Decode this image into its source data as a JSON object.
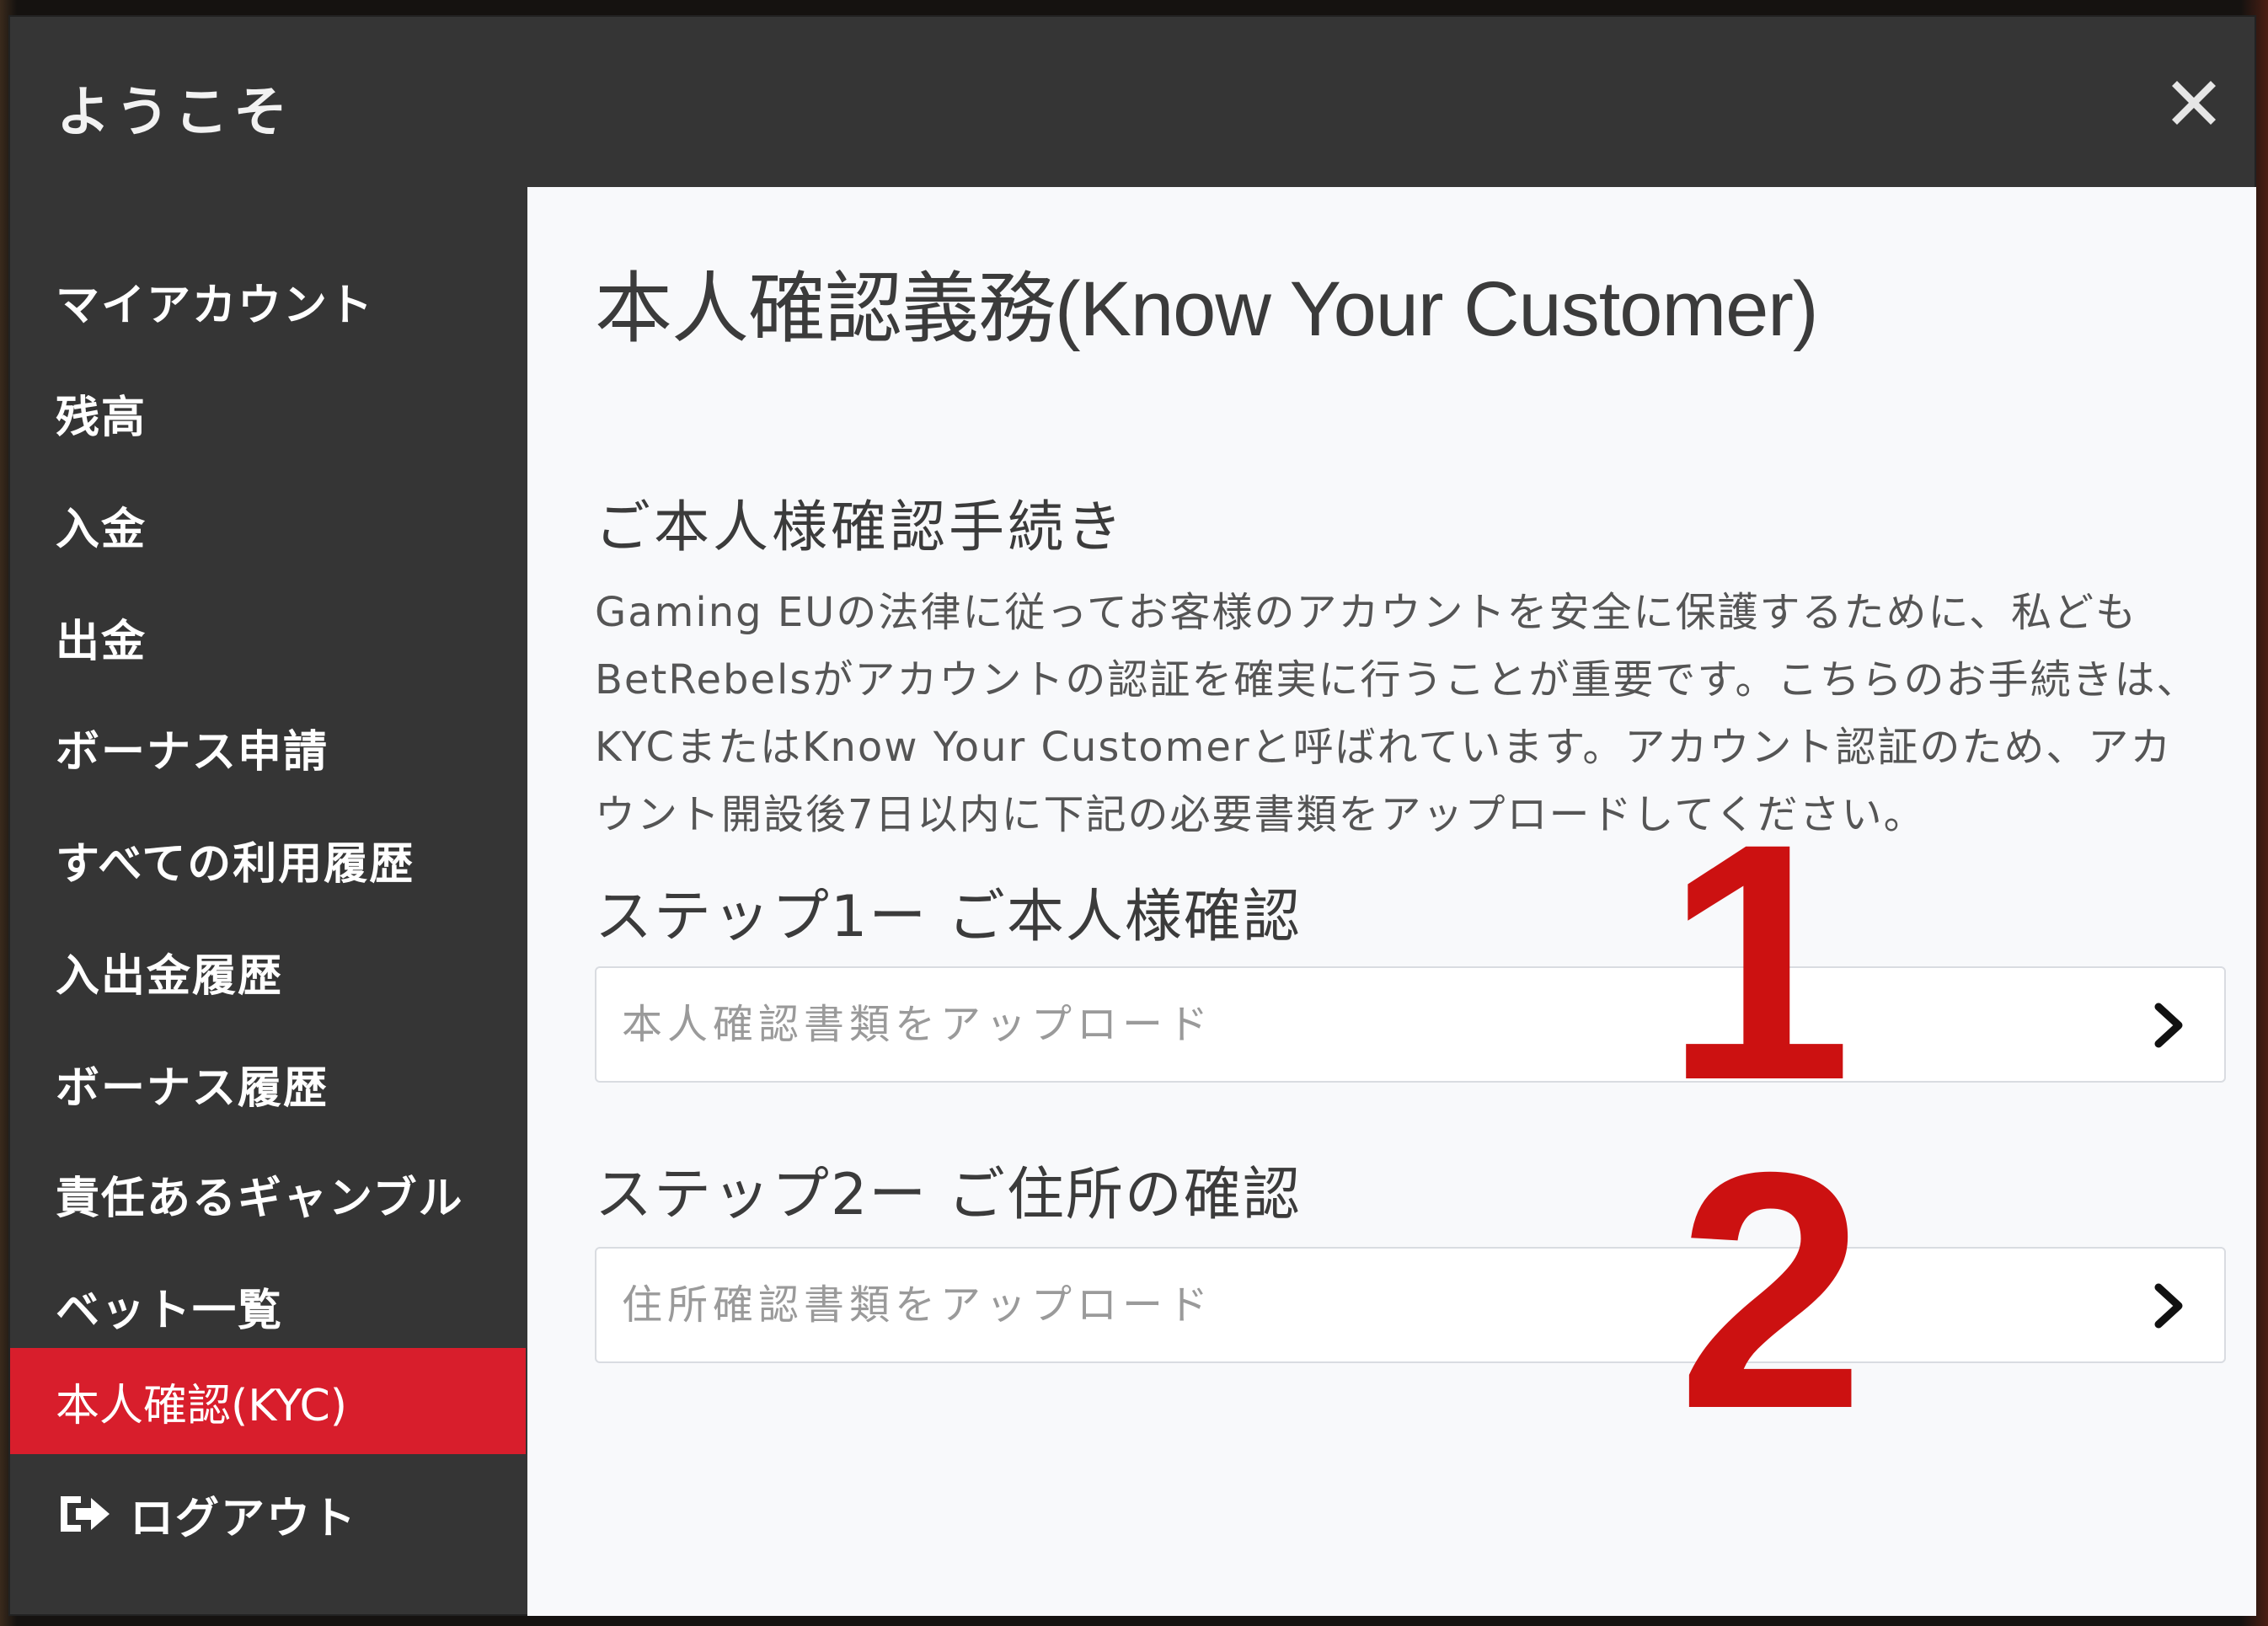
{
  "modal": {
    "title": "ようこそ",
    "close_icon": "close-icon"
  },
  "sidebar": {
    "items": [
      {
        "label": "マイアカウント"
      },
      {
        "label": "残高"
      },
      {
        "label": "入金"
      },
      {
        "label": "出金"
      },
      {
        "label": "ボーナス申請"
      },
      {
        "label": "すべての利用履歴"
      },
      {
        "label": "入出金履歴"
      },
      {
        "label": "ボーナス履歴"
      },
      {
        "label": "責任あるギャンブル"
      },
      {
        "label": "ベット一覧"
      },
      {
        "label": "本人確認(KYC)",
        "active": true
      },
      {
        "label": "ログアウト",
        "icon": "logout-icon"
      }
    ],
    "active_color": "#d81e2c"
  },
  "content": {
    "title": "本人確認義務(Know Your Customer)",
    "section_title": "ご本人様確認手続き",
    "intro": "Gaming EUの法律に従ってお客様のアカウントを安全に保護するために、私どもBetRebelsがアカウントの認証を確実に行うことが重要です。こちらのお手続きは、KYCまたはKnow Your Customerと呼ばれています。アカウント認証のため、アカウント開設後7日以内に下記の必要書類をアップロードしてください。",
    "steps": [
      {
        "title": "ステップ1ー ご本人様確認",
        "upload_label": "本人確認書類をアップロード",
        "annotation": "1"
      },
      {
        "title": "ステップ2ー ご住所の確認",
        "upload_label": "住所確認書類をアップロード",
        "annotation": "2"
      }
    ],
    "annotation_color": "#cc1111"
  }
}
